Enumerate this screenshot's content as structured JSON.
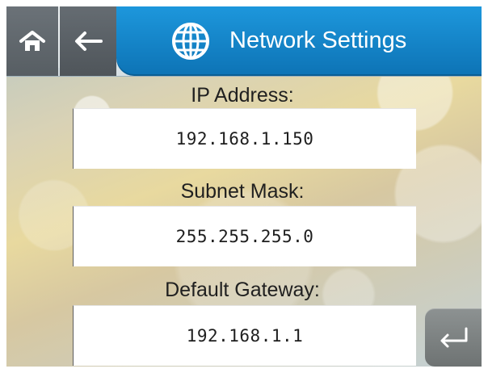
{
  "header": {
    "title": "Network Settings",
    "home_icon": "home-icon",
    "back_icon": "back-arrow-icon",
    "globe_icon": "globe-icon",
    "colors": {
      "header_blue": "#128bd0",
      "header_gray": "#5d6368"
    }
  },
  "fields": {
    "ip": {
      "label": "IP Address:",
      "value": "192.168.1.150"
    },
    "subnet": {
      "label": "Subnet Mask:",
      "value": "255.255.255.0"
    },
    "gateway": {
      "label": "Default Gateway:",
      "value": "192.168.1.1"
    }
  },
  "actions": {
    "enter_icon": "enter-icon"
  }
}
